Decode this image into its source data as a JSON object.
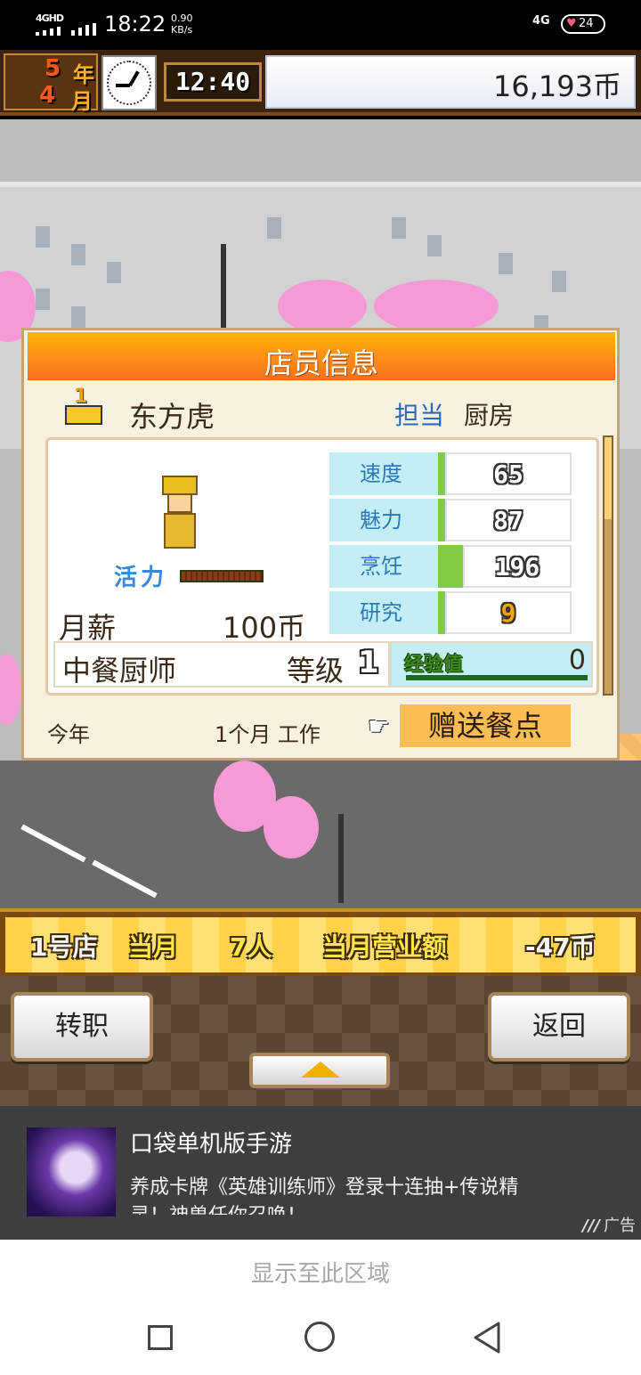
{
  "status_bar": {
    "network_type": "4GHD",
    "time": "18:22",
    "speed_value": "0.90",
    "speed_unit": "KB/s",
    "net_right": "4G",
    "battery": "24"
  },
  "header": {
    "year_num": "5",
    "year_unit": "年",
    "month_num": "4",
    "month_unit": "月",
    "game_time": "12:40",
    "money": "16,193币"
  },
  "dialog": {
    "title": "店员信息",
    "rank": "1",
    "staff_name": "东方虎",
    "assign_label": "担当",
    "assign_value": "厨房",
    "stamina_label": "活力",
    "stamina_level": 1.0,
    "salary_label": "月薪",
    "salary_value": "100币",
    "stats": [
      {
        "name": "速度",
        "value": "65",
        "highlight": false
      },
      {
        "name": "魅力",
        "value": "87",
        "highlight": false
      },
      {
        "name": "烹饪",
        "value": "196",
        "highlight": false
      },
      {
        "name": "研究",
        "value": "9",
        "highlight": true
      }
    ],
    "job": "中餐厨师",
    "level_label": "等级",
    "level_value": "1",
    "exp_label": "经验值",
    "exp_value": "0",
    "footer_year": "今年",
    "footer_worked": "1个月 工作",
    "gift_button": "赠送餐点"
  },
  "shop_strip": {
    "shop": "1号店",
    "month_label": "当月",
    "staff_count": "7人",
    "sales_label": "当月营业额",
    "sales_value": "-47币"
  },
  "buttons": {
    "transfer": "转职",
    "back": "返回"
  },
  "ad": {
    "title": "口袋单机版手游",
    "description": "养成卡牌《英雄训练师》登录十连抽+传说精灵！神兽任你召唤！",
    "badge": "广告"
  },
  "system": {
    "display_hint": "显示至此区域"
  },
  "colors": {
    "title_orange": "#ff8a1a",
    "stat_cyan": "#c4eef6",
    "stat_green": "#84cc44",
    "gift_orange": "#fbbd54"
  }
}
